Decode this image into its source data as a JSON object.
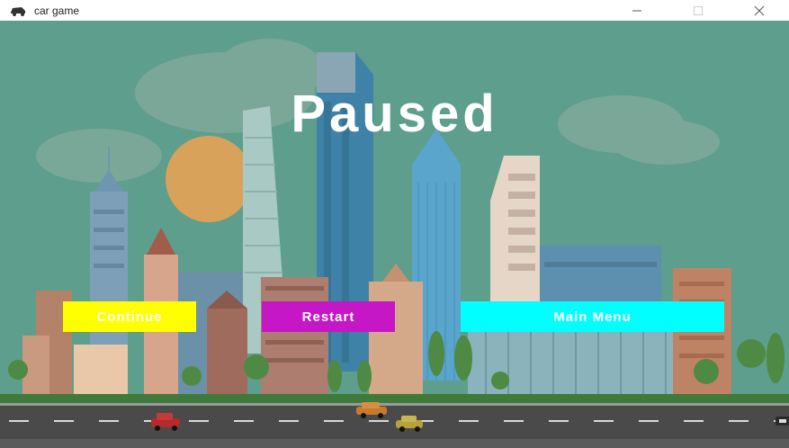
{
  "window": {
    "title": "car game",
    "controls": [
      "minimize-icon",
      "maximize-icon",
      "close-icon"
    ]
  },
  "game": {
    "pause_title": "Paused",
    "buttons": {
      "continue": "Continue",
      "restart": "Restart",
      "main_menu": "Main Menu"
    },
    "colors": {
      "sky": "#5e9e8c",
      "continue": "#ffff00",
      "restart": "#c617c6",
      "main_menu": "#00ffff",
      "road": "#4a4a4a"
    }
  }
}
